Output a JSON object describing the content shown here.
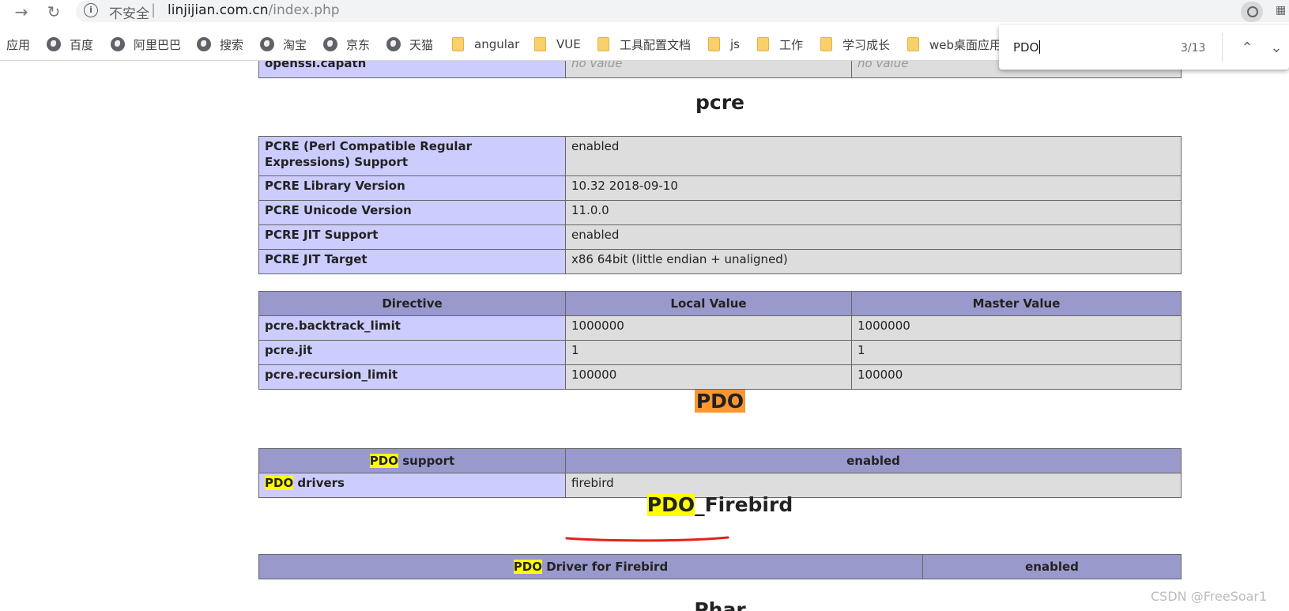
{
  "browser": {
    "security_label": "不安全",
    "url_host": "linjijian.com.cn",
    "url_path": "/index.php",
    "bookmarks": [
      {
        "label": "应用",
        "type": "apps"
      },
      {
        "label": "百度",
        "type": "site"
      },
      {
        "label": "阿里巴巴",
        "type": "site"
      },
      {
        "label": "搜索",
        "type": "site"
      },
      {
        "label": "淘宝",
        "type": "site"
      },
      {
        "label": "京东",
        "type": "site"
      },
      {
        "label": "天猫",
        "type": "site"
      },
      {
        "label": "angular",
        "type": "folder"
      },
      {
        "label": "VUE",
        "type": "folder"
      },
      {
        "label": "工具配置文档",
        "type": "folder"
      },
      {
        "label": "js",
        "type": "folder"
      },
      {
        "label": "工作",
        "type": "folder"
      },
      {
        "label": "学习成长",
        "type": "folder"
      },
      {
        "label": "web桌面应用",
        "type": "folder"
      }
    ]
  },
  "findbar": {
    "query": "PDO",
    "count": "3/13",
    "prev_icon": "chevron-up-icon",
    "next_icon": "chevron-down-icon"
  },
  "phpinfo": {
    "openssl_row": {
      "name": "openssl.capath",
      "local": "no value",
      "master": "no value"
    },
    "pcre": {
      "heading": "pcre",
      "info_rows": [
        {
          "name": "PCRE (Perl Compatible Regular Expressions) Support",
          "value": "enabled"
        },
        {
          "name": "PCRE Library Version",
          "value": "10.32 2018-09-10"
        },
        {
          "name": "PCRE Unicode Version",
          "value": "11.0.0"
        },
        {
          "name": "PCRE JIT Support",
          "value": "enabled"
        },
        {
          "name": "PCRE JIT Target",
          "value": "x86 64bit (little endian + unaligned)"
        }
      ],
      "directive_headers": {
        "directive": "Directive",
        "local": "Local Value",
        "master": "Master Value"
      },
      "directives": [
        {
          "name": "pcre.backtrack_limit",
          "local": "1000000",
          "master": "1000000"
        },
        {
          "name": "pcre.jit",
          "local": "1",
          "master": "1"
        },
        {
          "name": "pcre.recursion_limit",
          "local": "100000",
          "master": "100000"
        }
      ]
    },
    "pdo": {
      "heading": "PDO",
      "support_prefix": "PDO",
      "support_suffix": " support",
      "support_value": "enabled",
      "drivers_prefix": "PDO",
      "drivers_suffix": " drivers",
      "drivers_value": "firebird",
      "annotation_color": "#e0231c"
    },
    "pdo_firebird": {
      "heading_prefix": "PDO",
      "heading_suffix": "_Firebird",
      "driver_prefix": "PDO",
      "driver_suffix": " Driver for Firebird",
      "driver_value": "enabled"
    },
    "next_heading": "Phar"
  },
  "watermark": "CSDN @FreeSoar1",
  "colors": {
    "header_bg": "#9999cc",
    "name_bg": "#ccccff",
    "value_bg": "#dddddd",
    "find_match": "#ffff00",
    "find_current": "#ff9632"
  }
}
